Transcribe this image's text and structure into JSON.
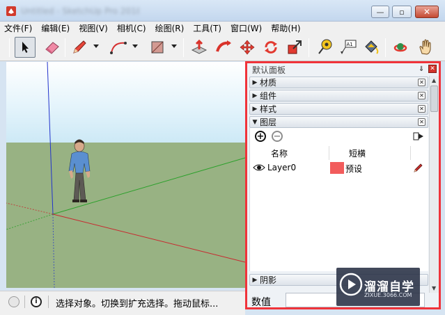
{
  "window": {
    "title": "Untitled - SketchUp Pro 2018",
    "min_glyph": "—",
    "max_glyph": "▫",
    "close_glyph": "✕"
  },
  "menu": {
    "items": [
      "文件(F)",
      "编辑(E)",
      "视图(V)",
      "相机(C)",
      "绘图(R)",
      "工具(T)",
      "窗口(W)",
      "帮助(H)"
    ]
  },
  "toolbar": {
    "tools": [
      "select-tool",
      "eraser-tool",
      "pencil-line-tool",
      "arc-tool",
      "rectangle-tool",
      "push-pull-tool",
      "follow-me-tool",
      "move-tool",
      "rotate-tool",
      "scale-tool",
      "tape-measure-tool",
      "text-tool",
      "paint-bucket-tool",
      "orbit-tool",
      "pan-tool"
    ],
    "text_tool_label": "A1"
  },
  "tray": {
    "title": "默认面板",
    "pin_glyph": "⇓",
    "close_glyph": "✕",
    "sections": [
      {
        "label": "材质",
        "expanded": false
      },
      {
        "label": "组件",
        "expanded": false
      },
      {
        "label": "样式",
        "expanded": false
      },
      {
        "label": "图层",
        "expanded": true
      }
    ],
    "layers": {
      "add_glyph": "+",
      "remove_glyph": "−",
      "columns": [
        "名称",
        "短横"
      ],
      "rows": [
        {
          "name": "Layer0",
          "color": "#f25c5c",
          "tag": "预设"
        }
      ]
    },
    "shadow_section": "阴影",
    "value_label": "数值",
    "value": ""
  },
  "statusbar": {
    "info_glyph": "i",
    "text": "选择对象。切换到扩充选择。拖动鼠标..."
  },
  "watermark": {
    "title": "溜溜自学",
    "url": "ZIXUE.3066.COM"
  },
  "colors": {
    "tray_border": "#f0333a",
    "ground": "#98b283",
    "red_axis": "#c8282f",
    "green_axis": "#2aa02a",
    "blue_axis": "#2233cc"
  }
}
